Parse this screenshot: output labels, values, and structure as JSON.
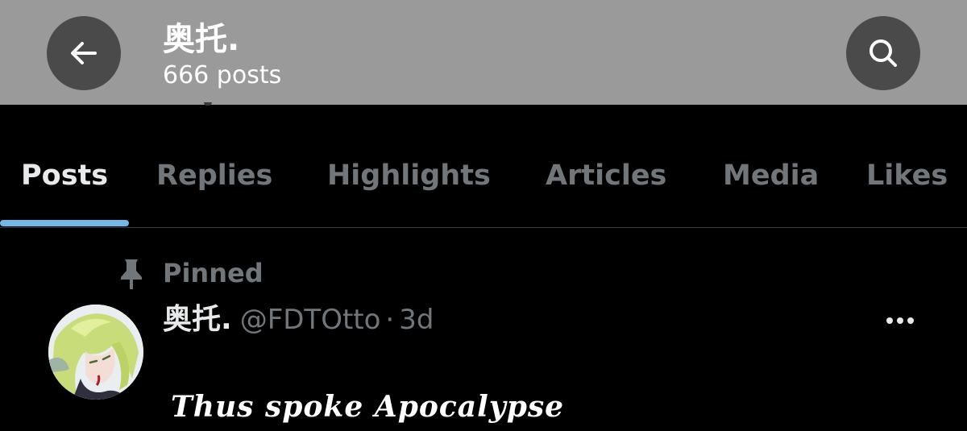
{
  "header": {
    "title": "奥托.",
    "subtitle": "666 posts",
    "back_icon": "arrow-left-icon",
    "search_icon": "search-icon",
    "background": "#9a9a9a"
  },
  "tabs": [
    {
      "label": "Posts",
      "active": true
    },
    {
      "label": "Replies",
      "active": false
    },
    {
      "label": "Highlights",
      "active": false
    },
    {
      "label": "Articles",
      "active": false
    },
    {
      "label": "Media",
      "active": false
    },
    {
      "label": "Likes",
      "active": false
    }
  ],
  "post": {
    "pinned_label": "Pinned",
    "pin_icon": "pin-icon",
    "author_name": "奥托.",
    "handle": "@FDTOtto",
    "separator": "·",
    "time": "3d",
    "more_icon": "more-horizontal-icon",
    "text": "Thus spoke Apocalypse"
  },
  "colors": {
    "active_tab": "#e7e9ea",
    "inactive_tab": "#71767b",
    "indicator": "#71b7e8",
    "background": "#000000"
  }
}
